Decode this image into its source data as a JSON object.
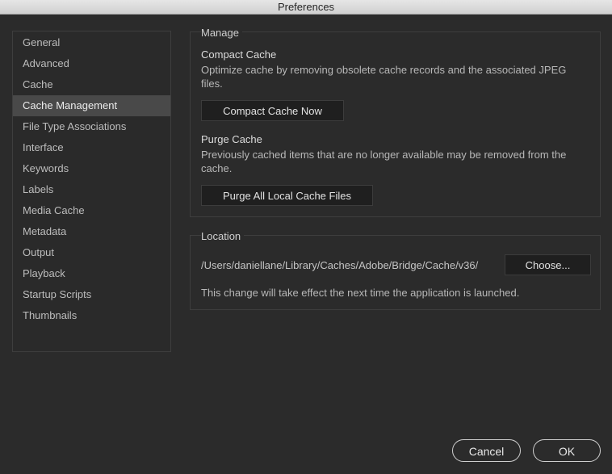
{
  "window": {
    "title": "Preferences"
  },
  "sidebar": {
    "items": [
      {
        "label": "General"
      },
      {
        "label": "Advanced"
      },
      {
        "label": "Cache"
      },
      {
        "label": "Cache Management",
        "selected": true
      },
      {
        "label": "File Type Associations"
      },
      {
        "label": "Interface"
      },
      {
        "label": "Keywords"
      },
      {
        "label": "Labels"
      },
      {
        "label": "Media Cache"
      },
      {
        "label": "Metadata"
      },
      {
        "label": "Output"
      },
      {
        "label": "Playback"
      },
      {
        "label": "Startup Scripts"
      },
      {
        "label": "Thumbnails"
      }
    ]
  },
  "manage": {
    "title": "Manage",
    "compact": {
      "heading": "Compact Cache",
      "description": "Optimize cache by removing obsolete cache records and the associated JPEG files.",
      "button": "Compact Cache Now"
    },
    "purge": {
      "heading": "Purge Cache",
      "description": "Previously cached items that are no longer available may be removed from the cache.",
      "button": "Purge All Local Cache Files"
    }
  },
  "location": {
    "title": "Location",
    "path": "/Users/daniellane/Library/Caches/Adobe/Bridge/Cache/v36/",
    "choose_button": "Choose...",
    "note": "This change will take effect the next time the application is launched."
  },
  "footer": {
    "cancel": "Cancel",
    "ok": "OK"
  }
}
